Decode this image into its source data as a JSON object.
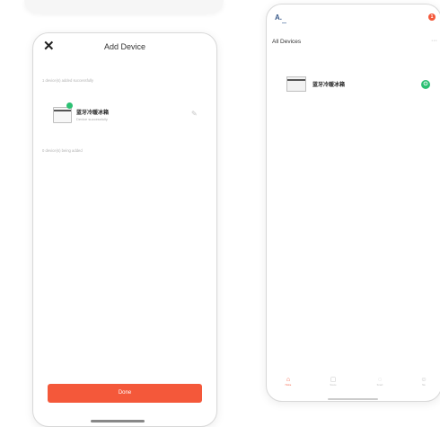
{
  "left_screen": {
    "close_icon": "✕",
    "title": "Add Device",
    "section_added_caption": "1 device(s) added successfully",
    "device_name": "蓝牙冷暖冰箱",
    "device_subtitle": "Device successfully",
    "section_being_added_caption": "0 device(s) being added",
    "done_label": "Done"
  },
  "right_screen": {
    "home_name": "A.",
    "notification_count": "1",
    "list_title": "All Devices",
    "more_icon": "···",
    "device_name": "蓝牙冷暖冰箱",
    "tabs": [
      {
        "label": "Home",
        "icon": "home-icon"
      },
      {
        "label": "Scene",
        "icon": "scene-icon"
      },
      {
        "label": "Smart",
        "icon": "smart-icon"
      },
      {
        "label": "Me",
        "icon": "me-icon"
      }
    ]
  },
  "colors": {
    "accent": "#f4583a",
    "online_green": "#2cc073"
  }
}
